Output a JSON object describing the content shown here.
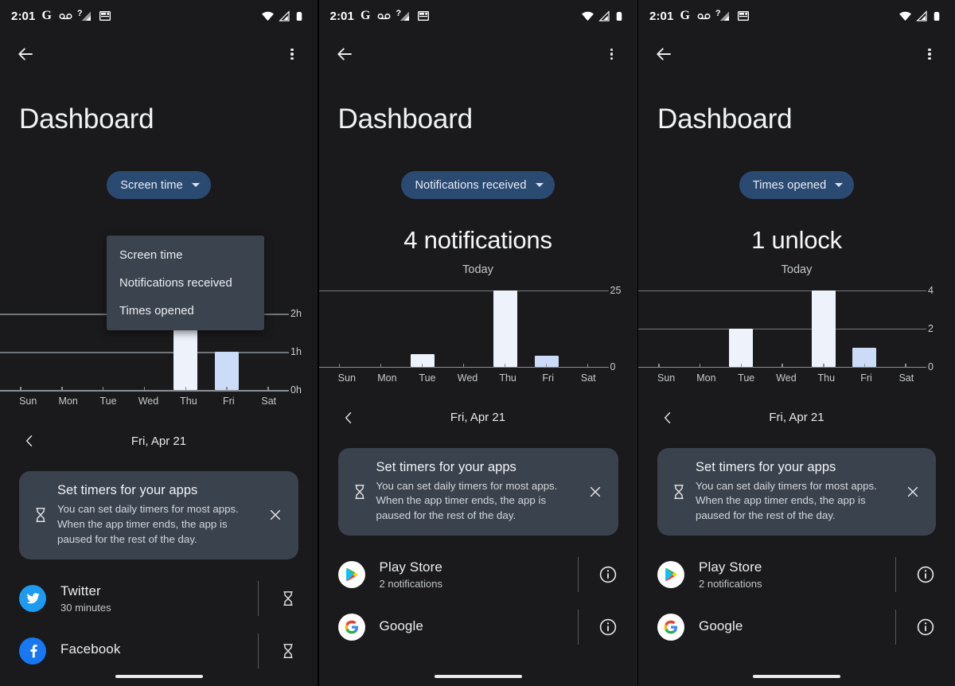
{
  "status_bar": {
    "time": "2:01",
    "left_icons": [
      "google-g-icon",
      "voicemail-icon",
      "signal-unknown-icon",
      "calendar-icon"
    ],
    "right_icons": [
      "wifi-icon",
      "cell-signal-icon",
      "battery-icon"
    ]
  },
  "app_bar": {
    "back_icon": "arrow-back-icon",
    "overflow_icon": "more-vert-icon"
  },
  "page_title": "Dashboard",
  "colors": {
    "background": "#1a1a1c",
    "chip": "#2b4a72",
    "menu": "#3b434f",
    "card": "#3a424e",
    "bar_primary": "#eef2fb",
    "bar_today": "#ccdcf8",
    "gridline": "#71767c",
    "text_primary": "#f1f3f4",
    "text_secondary": "#c4c7ca"
  },
  "date_nav": {
    "prev_icon": "chevron-left-icon",
    "label": "Fri, Apr 21"
  },
  "tip_card": {
    "icon": "hourglass-icon",
    "title": "Set timers for your apps",
    "body": "You can set daily timers for most apps. When the app timer ends, the app is paused for the rest of the day.",
    "close_icon": "close-icon"
  },
  "panels": [
    {
      "id": "panel-screen-time",
      "chip_label": "Screen time",
      "chip_caret_icon": "chevron-down-icon",
      "menu_open": true,
      "menu_items": [
        "Screen time",
        "Notifications received",
        "Times opened"
      ],
      "headline": "",
      "headline_sub": "",
      "chart_data": {
        "type": "bar",
        "title": "Screen time",
        "categories": [
          "Sun",
          "Mon",
          "Tue",
          "Wed",
          "Thu",
          "Fri",
          "Sat"
        ],
        "values": [
          0,
          0,
          0,
          0,
          1.75,
          1.0,
          0
        ],
        "today_index": 5,
        "ylim": [
          0,
          2
        ],
        "yticks": [
          0,
          1,
          2
        ],
        "ytick_labels": [
          "0h",
          "1h",
          "2h"
        ],
        "xlabel": "",
        "ylabel": "",
        "grid": true,
        "legend": "none"
      },
      "apps": [
        {
          "name": "Twitter",
          "detail": "30 minutes",
          "icon": "twitter-icon",
          "action_icon": "hourglass-icon"
        },
        {
          "name": "Facebook",
          "detail": "",
          "icon": "facebook-icon",
          "action_icon": "hourglass-icon"
        }
      ]
    },
    {
      "id": "panel-notifications",
      "chip_label": "Notifications received",
      "chip_caret_icon": "chevron-down-icon",
      "menu_open": false,
      "menu_items": [],
      "headline": "4 notifications",
      "headline_sub": "Today",
      "chart_data": {
        "type": "bar",
        "title": "Notifications received",
        "categories": [
          "Sun",
          "Mon",
          "Tue",
          "Wed",
          "Thu",
          "Fri",
          "Sat"
        ],
        "values": [
          0,
          0,
          4,
          0,
          25,
          3.5,
          0
        ],
        "today_index": 5,
        "ylim": [
          0,
          25
        ],
        "yticks": [
          0,
          25
        ],
        "ytick_labels": [
          "0",
          "25"
        ],
        "xlabel": "",
        "ylabel": "",
        "grid": true,
        "legend": "none"
      },
      "apps": [
        {
          "name": "Play Store",
          "detail": "2 notifications",
          "icon": "play-store-icon",
          "action_icon": "info-icon"
        },
        {
          "name": "Google",
          "detail": "",
          "icon": "google-icon",
          "action_icon": "info-icon"
        }
      ]
    },
    {
      "id": "panel-times-opened",
      "chip_label": "Times opened",
      "chip_caret_icon": "chevron-down-icon",
      "menu_open": false,
      "menu_items": [],
      "headline": "1 unlock",
      "headline_sub": "Today",
      "chart_data": {
        "type": "bar",
        "title": "Times opened",
        "categories": [
          "Sun",
          "Mon",
          "Tue",
          "Wed",
          "Thu",
          "Fri",
          "Sat"
        ],
        "values": [
          0,
          0,
          2,
          0,
          4,
          1,
          0
        ],
        "today_index": 5,
        "ylim": [
          0,
          4
        ],
        "yticks": [
          0,
          2,
          4
        ],
        "ytick_labels": [
          "0",
          "2",
          "4"
        ],
        "xlabel": "",
        "ylabel": "",
        "grid": true,
        "legend": "none"
      },
      "apps": [
        {
          "name": "Play Store",
          "detail": "2 notifications",
          "icon": "play-store-icon",
          "action_icon": "info-icon"
        },
        {
          "name": "Google",
          "detail": "",
          "icon": "google-icon",
          "action_icon": "info-icon"
        }
      ]
    }
  ]
}
